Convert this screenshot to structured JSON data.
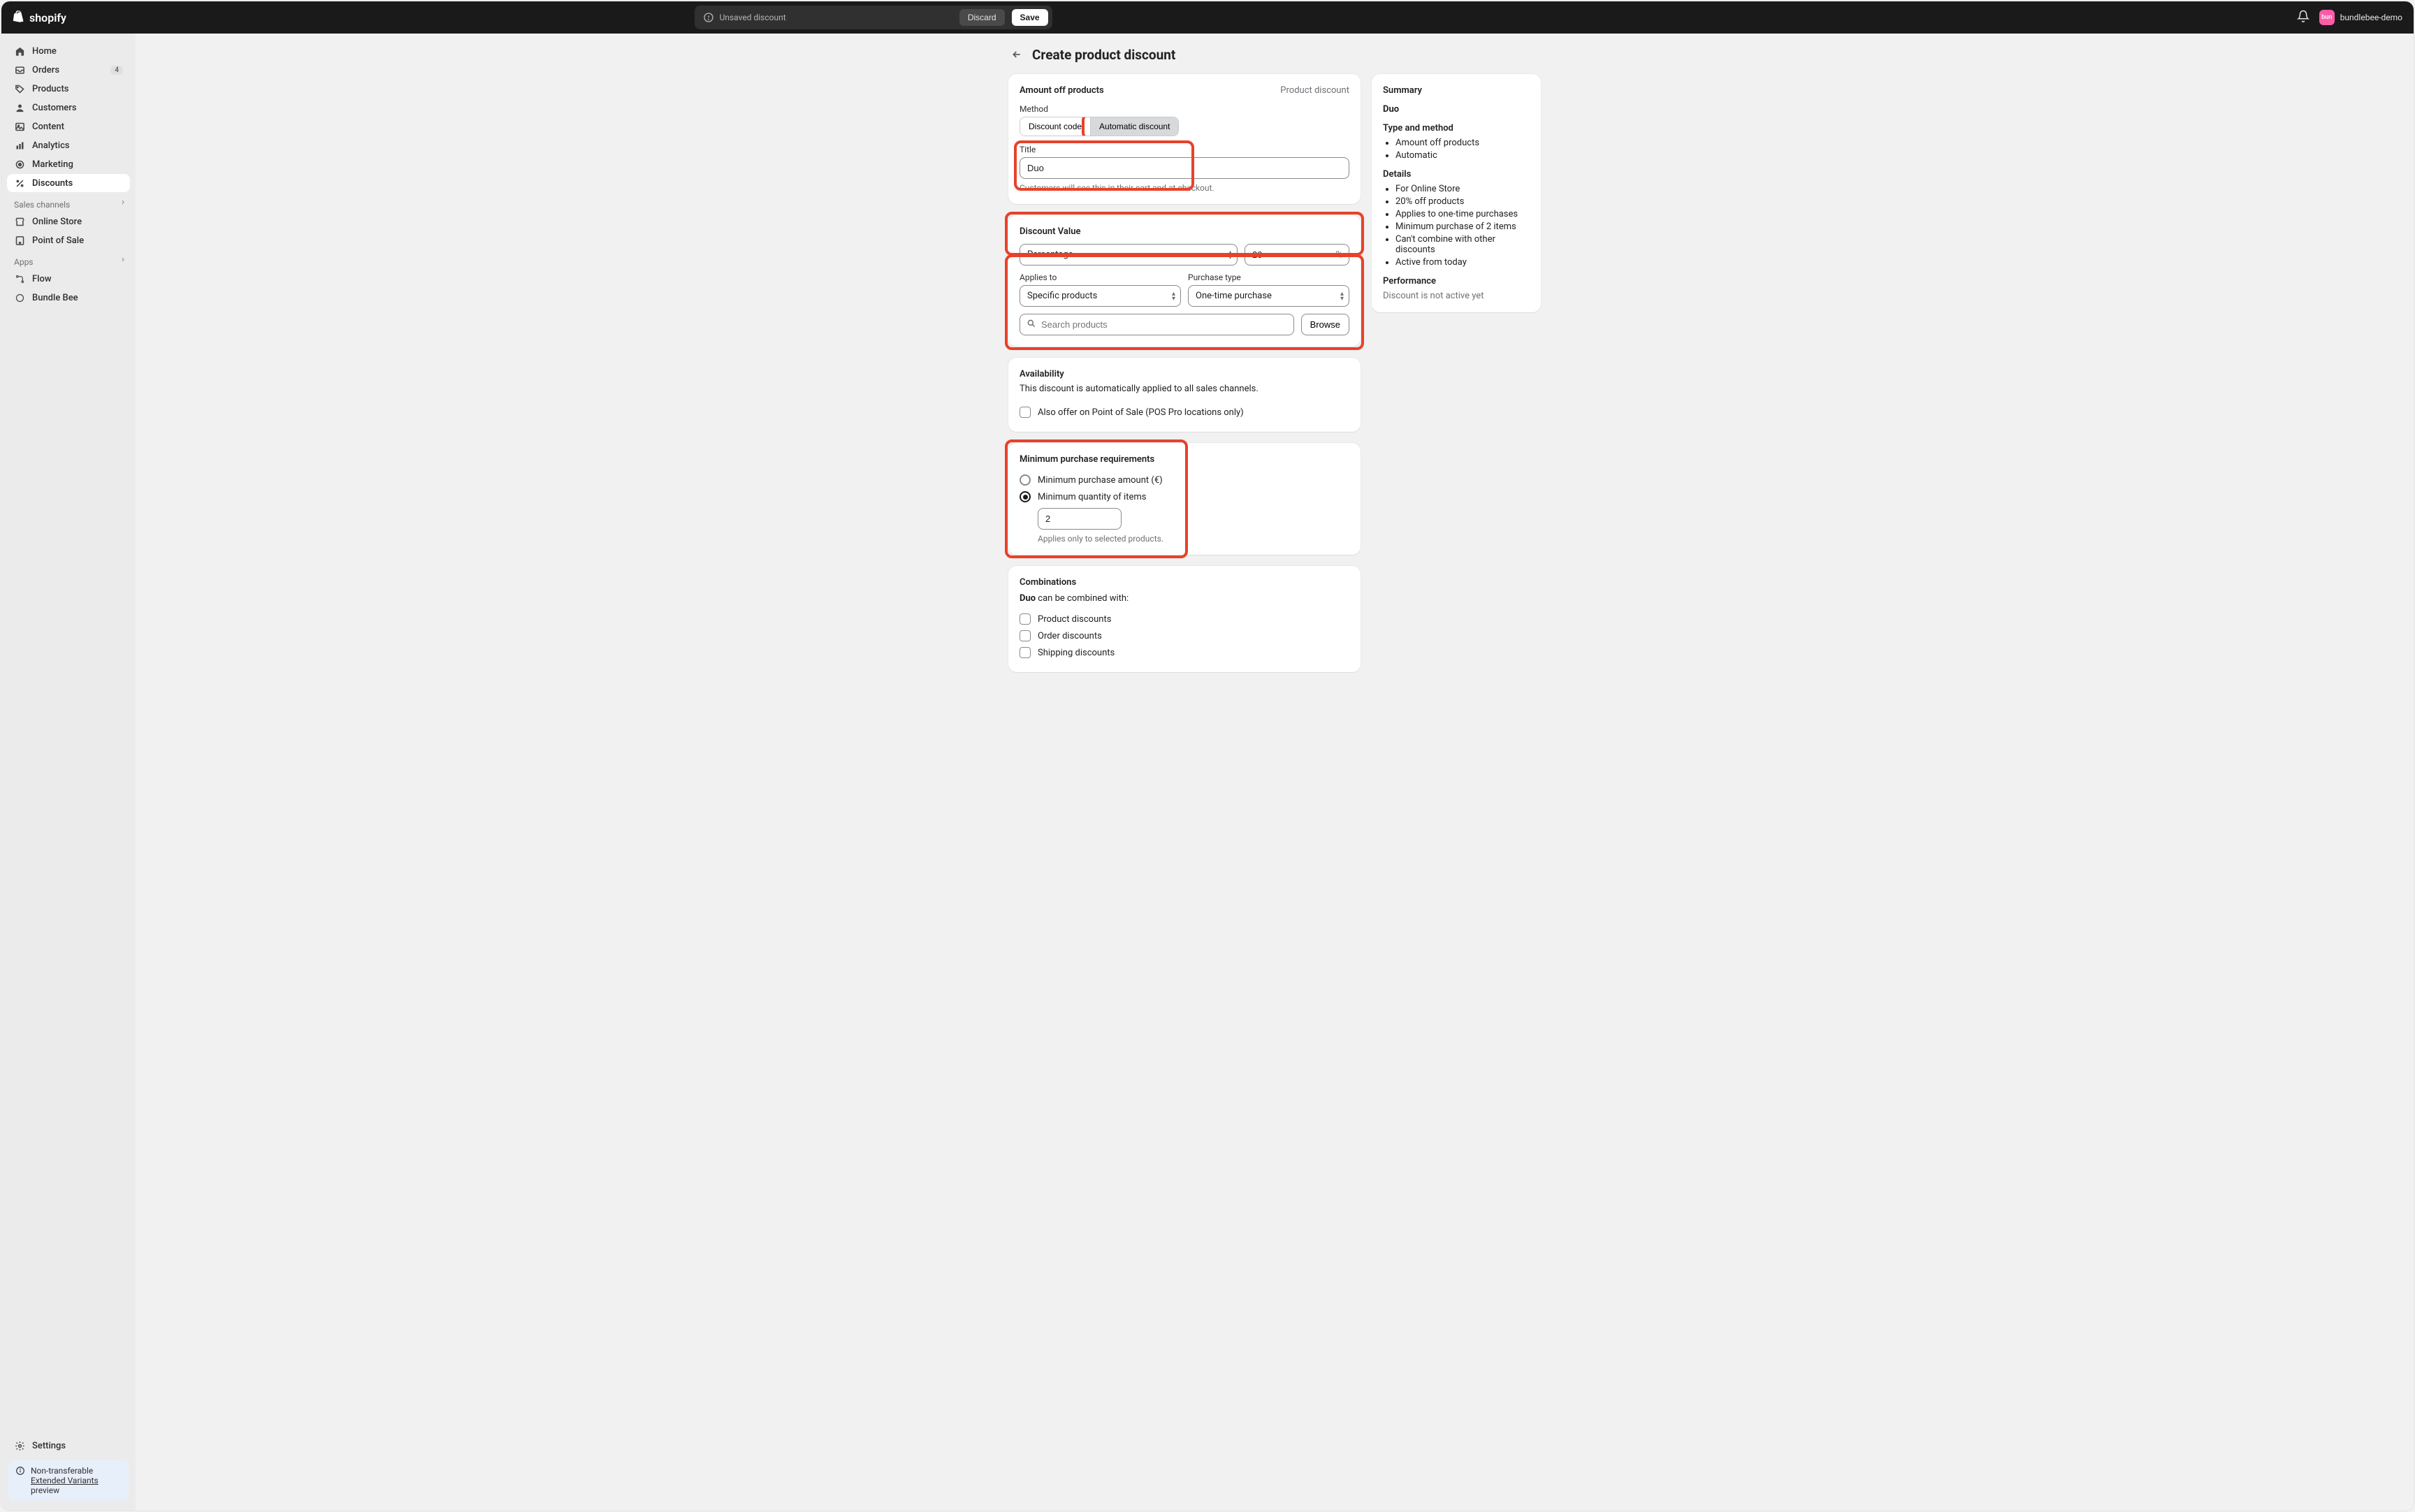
{
  "topbar": {
    "unsaved_msg": "Unsaved discount",
    "discard": "Discard",
    "save": "Save",
    "store_name": "bundlebee-demo",
    "avatar_initials": "bun"
  },
  "nav": {
    "home": "Home",
    "orders": "Orders",
    "orders_badge": "4",
    "products": "Products",
    "customers": "Customers",
    "content": "Content",
    "analytics": "Analytics",
    "marketing": "Marketing",
    "discounts": "Discounts",
    "sales_channels": "Sales channels",
    "online_store": "Online Store",
    "pos": "Point of Sale",
    "apps": "Apps",
    "flow": "Flow",
    "bundle_bee": "Bundle Bee",
    "settings": "Settings",
    "preview_title": "Non-transferable",
    "preview_link": "Extended Variants",
    "preview_suffix": " preview"
  },
  "page": {
    "title": "Create product discount"
  },
  "card1": {
    "title": "Amount off products",
    "kind": "Product discount",
    "method_label": "Method",
    "seg_code": "Discount code",
    "seg_auto": "Automatic discount",
    "title_label": "Title",
    "title_value": "Duo",
    "title_help": "Customers will see this in their cart and at checkout."
  },
  "card2": {
    "title": "Discount Value",
    "type_value": "Percentage",
    "value": "20",
    "suffix": "%",
    "applies_label": "Applies to",
    "applies_value": "Specific products",
    "purchase_label": "Purchase type",
    "purchase_value": "One-time purchase",
    "search_placeholder": "Search products",
    "browse": "Browse"
  },
  "card3": {
    "title": "Availability",
    "desc": "This discount is automatically applied to all sales channels.",
    "pos_label": "Also offer on Point of Sale (POS Pro locations only)"
  },
  "card4": {
    "title": "Minimum purchase requirements",
    "opt_amount": "Minimum purchase amount (€)",
    "opt_qty": "Minimum quantity of items",
    "qty_value": "2",
    "qty_help": "Applies only to selected products."
  },
  "card5": {
    "title": "Combinations",
    "lead_name": "Duo",
    "lead_rest": " can be combined with:",
    "c1": "Product discounts",
    "c2": "Order discounts",
    "c3": "Shipping discounts"
  },
  "summary": {
    "heading": "Summary",
    "name": "Duo",
    "type_heading": "Type and method",
    "type_1": "Amount off products",
    "type_2": "Automatic",
    "details_heading": "Details",
    "d1": "For Online Store",
    "d2": "20% off products",
    "d3": "Applies to one-time purchases",
    "d4": "Minimum purchase of 2 items",
    "d5": "Can't combine with other discounts",
    "d6": "Active from today",
    "perf_heading": "Performance",
    "perf_text": "Discount is not active yet"
  }
}
